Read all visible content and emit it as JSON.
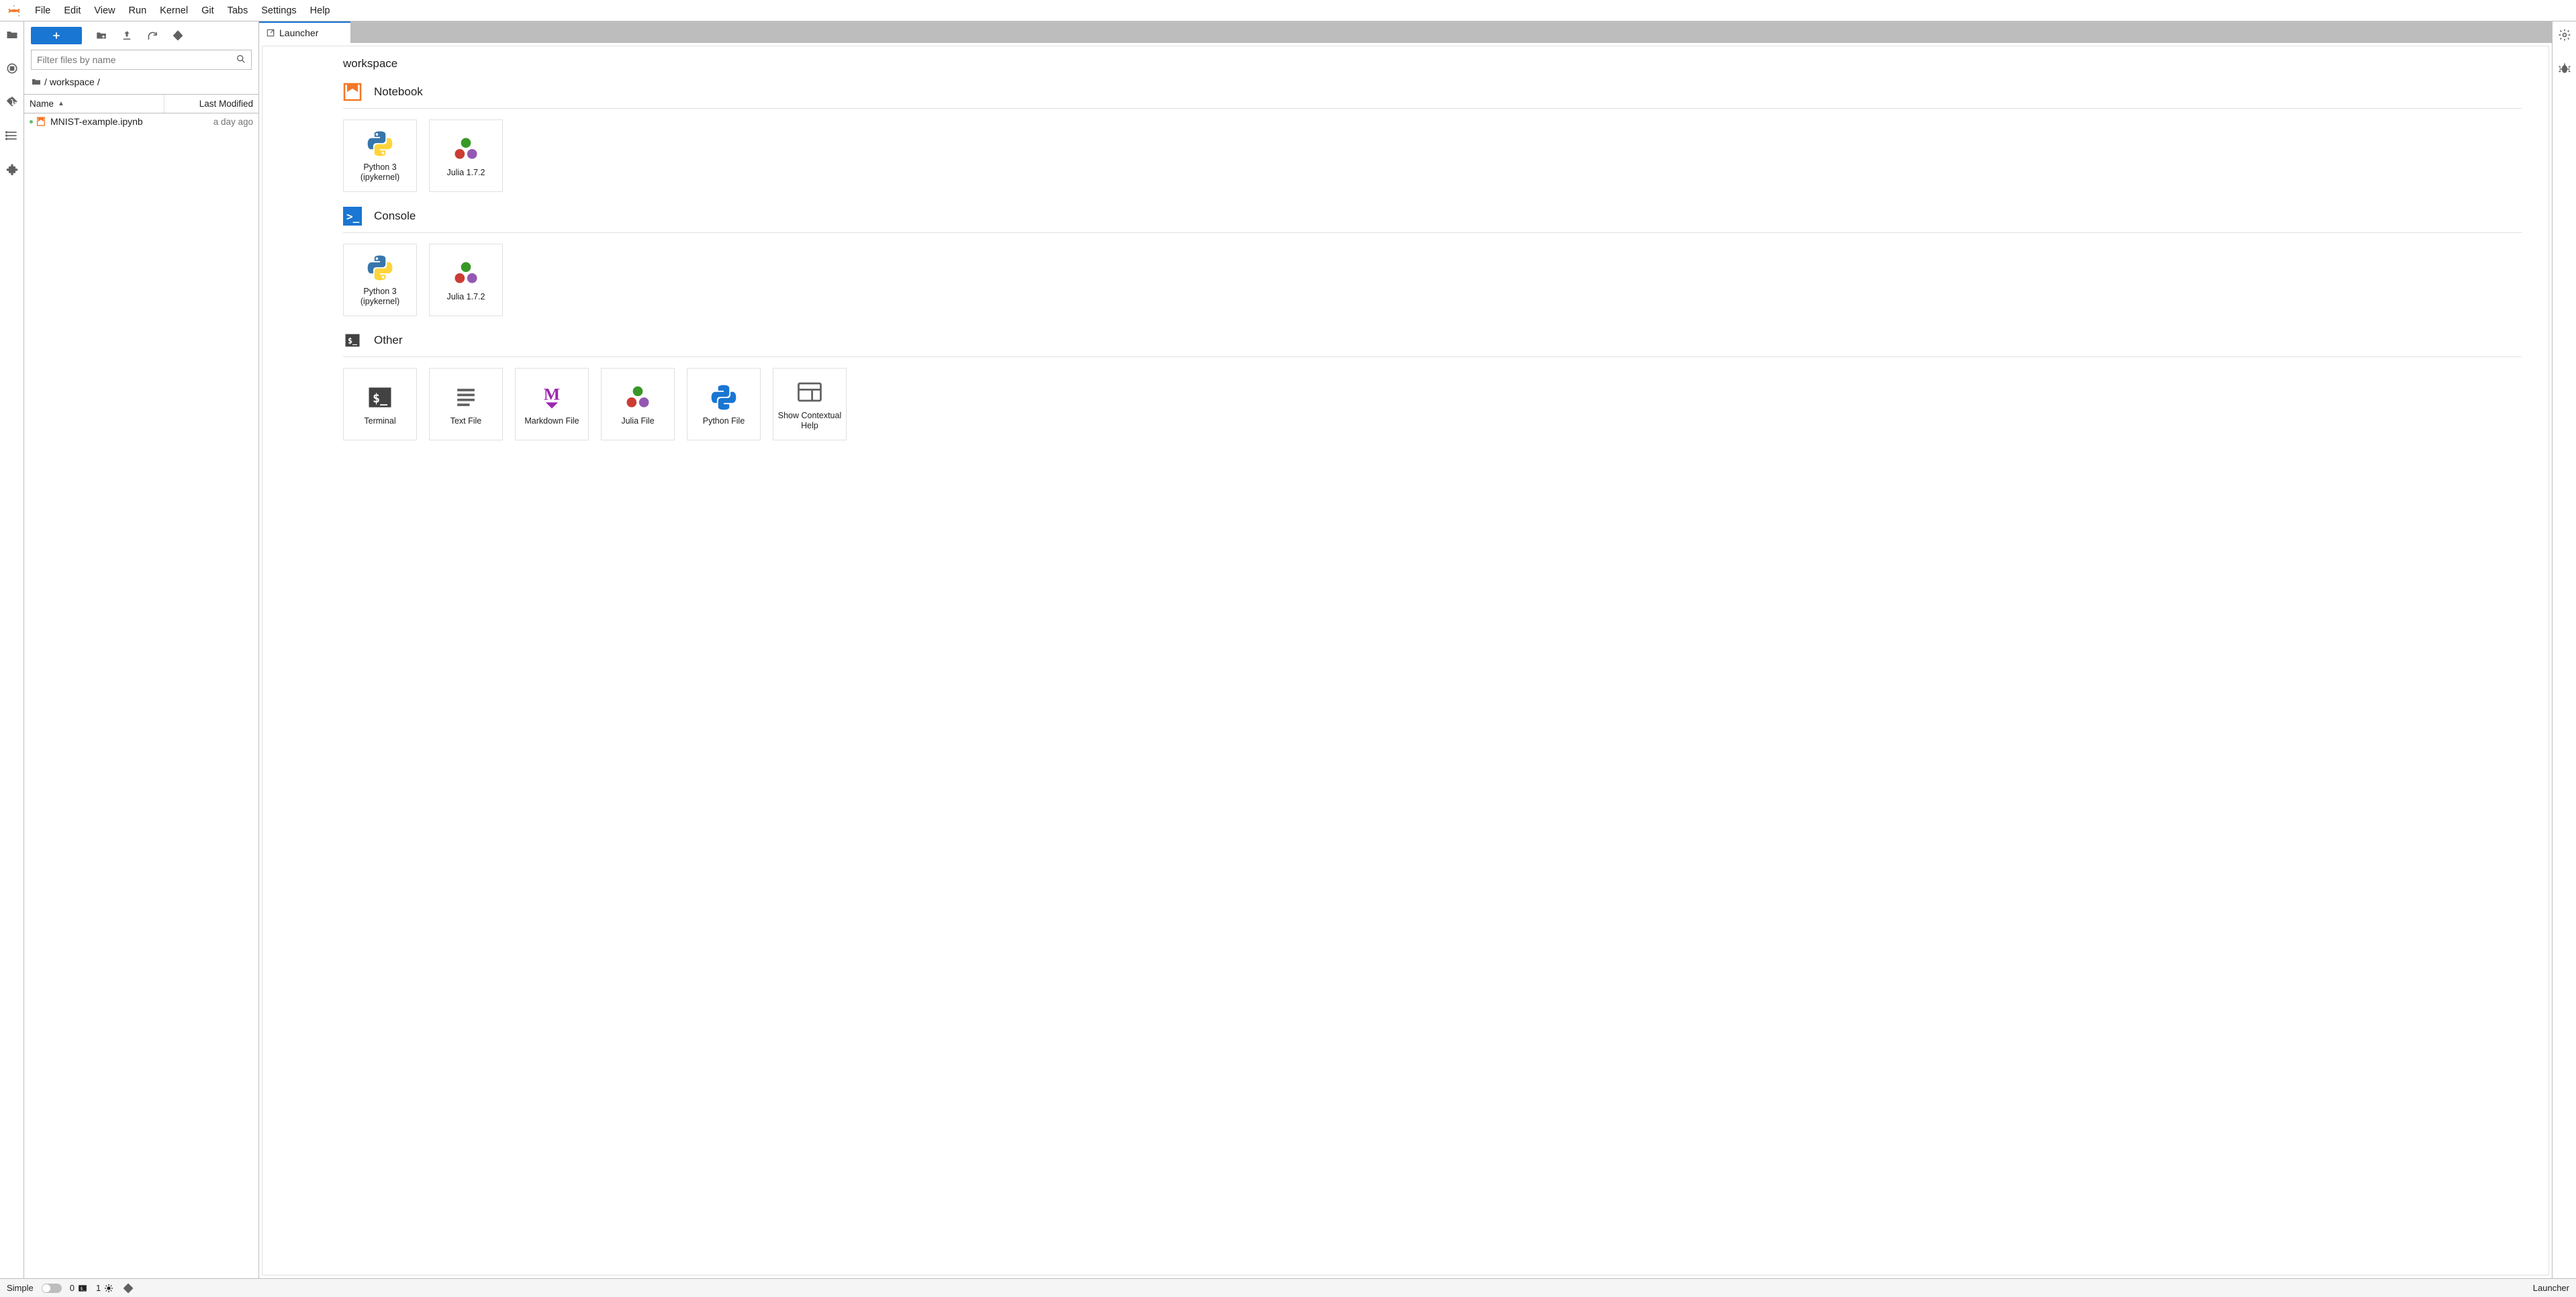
{
  "menu": [
    "File",
    "Edit",
    "View",
    "Run",
    "Kernel",
    "Git",
    "Tabs",
    "Settings",
    "Help"
  ],
  "filebrowser": {
    "filter_placeholder": "Filter files by name",
    "breadcrumb": [
      "/",
      "workspace",
      "/"
    ],
    "columns": {
      "name": "Name",
      "modified": "Last Modified"
    },
    "items": [
      {
        "name": "MNIST-example.ipynb",
        "modified": "a day ago",
        "modified_status": true
      }
    ]
  },
  "tab": {
    "title": "Launcher"
  },
  "launcher": {
    "path": "workspace",
    "sections": [
      {
        "title": "Notebook",
        "icon": "notebook",
        "cards": [
          {
            "label": "Python 3 (ipykernel)",
            "icon": "python"
          },
          {
            "label": "Julia 1.7.2",
            "icon": "julia"
          }
        ]
      },
      {
        "title": "Console",
        "icon": "console",
        "cards": [
          {
            "label": "Python 3 (ipykernel)",
            "icon": "python"
          },
          {
            "label": "Julia 1.7.2",
            "icon": "julia"
          }
        ]
      },
      {
        "title": "Other",
        "icon": "terminal",
        "cards": [
          {
            "label": "Terminal",
            "icon": "terminal"
          },
          {
            "label": "Text File",
            "icon": "text"
          },
          {
            "label": "Markdown File",
            "icon": "markdown"
          },
          {
            "label": "Julia File",
            "icon": "julia"
          },
          {
            "label": "Python File",
            "icon": "pyfile"
          },
          {
            "label": "Show Contextual Help",
            "icon": "help"
          }
        ]
      }
    ]
  },
  "statusbar": {
    "simple": "Simple",
    "terminals": "0",
    "kernels": "1",
    "right": "Launcher"
  }
}
